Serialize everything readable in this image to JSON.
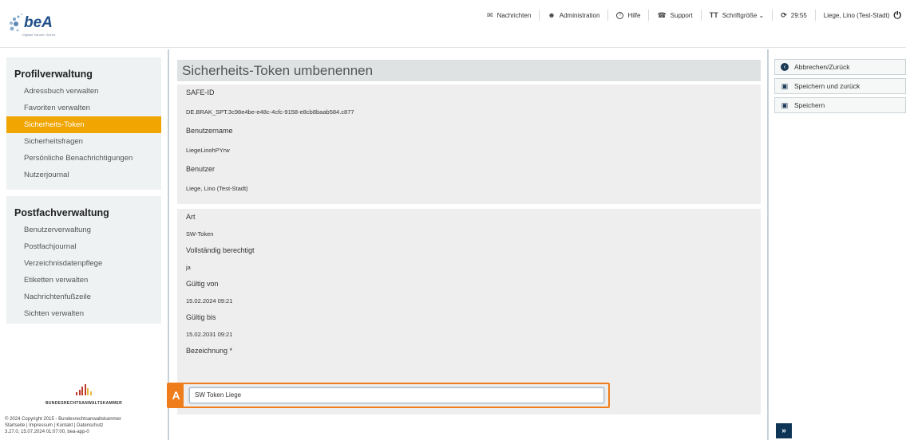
{
  "header": {
    "logo_text": "beA",
    "logo_tagline": "Digitale Kanzlei. Sicher.",
    "nav": [
      {
        "icon": "envelope-icon",
        "glyph": "✉",
        "label": "Nachrichten"
      },
      {
        "icon": "admin-users-icon",
        "glyph": "👥",
        "label": "Administration"
      },
      {
        "icon": "help-icon",
        "glyph": "?",
        "label": "Hilfe"
      },
      {
        "icon": "support-icon",
        "glyph": "☎",
        "label": "Support"
      },
      {
        "icon": "font-size-icon",
        "glyph": "TT",
        "label": "Schriftgröße ⌄"
      },
      {
        "icon": "refresh-icon",
        "glyph": "⟳",
        "label": "29:55"
      }
    ],
    "user": "Liege, Lino (Test-Stadt)",
    "power_glyph": "⏻"
  },
  "sidebar": {
    "profile_title": "Profilverwaltung",
    "profile_items": [
      {
        "label": "Adressbuch verwalten",
        "active": false
      },
      {
        "label": "Favoriten verwalten",
        "active": false
      },
      {
        "label": "Sicherheits-Token",
        "active": true
      },
      {
        "label": "Sicherheitsfragen",
        "active": false
      },
      {
        "label": "Persönliche Benachrichtigungen",
        "active": false
      },
      {
        "label": "Nutzerjournal",
        "active": false
      }
    ],
    "postfach_title": "Postfachverwaltung",
    "postfach_items": [
      {
        "label": "Benutzerverwaltung"
      },
      {
        "label": "Postfachjournal"
      },
      {
        "label": "Verzeichnisdatenpflege"
      },
      {
        "label": "Etiketten verwalten"
      },
      {
        "label": "Nachrichtenfußzeile"
      },
      {
        "label": "Sichten verwalten"
      }
    ]
  },
  "brak": {
    "name": "BUNDESRECHTSANWALTSKAMMER"
  },
  "footer": {
    "line1": "© 2024 Copyright 2015 - Bundesrechtsanwaltskammer",
    "line2": "Startseite | Impressum | Kontakt | Datenschutz",
    "line3": "3.27.0, 15.07.2024 01:07:00, bea-app-0"
  },
  "main": {
    "title": "Sicherheits-Token umbenennen",
    "safe_id_label": "SAFE-ID",
    "safe_id_value": "DE.BRAK_SPT.3c98e4be-e48c-4cfc-9158-e8cb8baab584.c877",
    "username_label": "Benutzername",
    "username_value": "LiegeLinohPYrw",
    "user_label": "Benutzer",
    "user_value": "Liege, Lino (Test-Stadt)",
    "art_label": "Art",
    "art_value": "SW-Token",
    "full_label": "Vollständig berechtigt",
    "full_value": "ja",
    "valid_from_label": "Gültig von",
    "valid_from_value": "15.02.2024 09:21",
    "valid_to_label": "Gültig bis",
    "valid_to_value": "15.02.2031 09:21",
    "name_label": "Bezeichnung *",
    "name_value": "SW Token Liege",
    "marker": "A"
  },
  "actions": {
    "cancel": "Abbrechen/Zurück",
    "save_back": "Speichern und zurück",
    "save": "Speichern",
    "expand": "»"
  },
  "colors": {
    "accent": "#f0a500",
    "highlight": "#f07d1b",
    "navy": "#0f3556"
  }
}
